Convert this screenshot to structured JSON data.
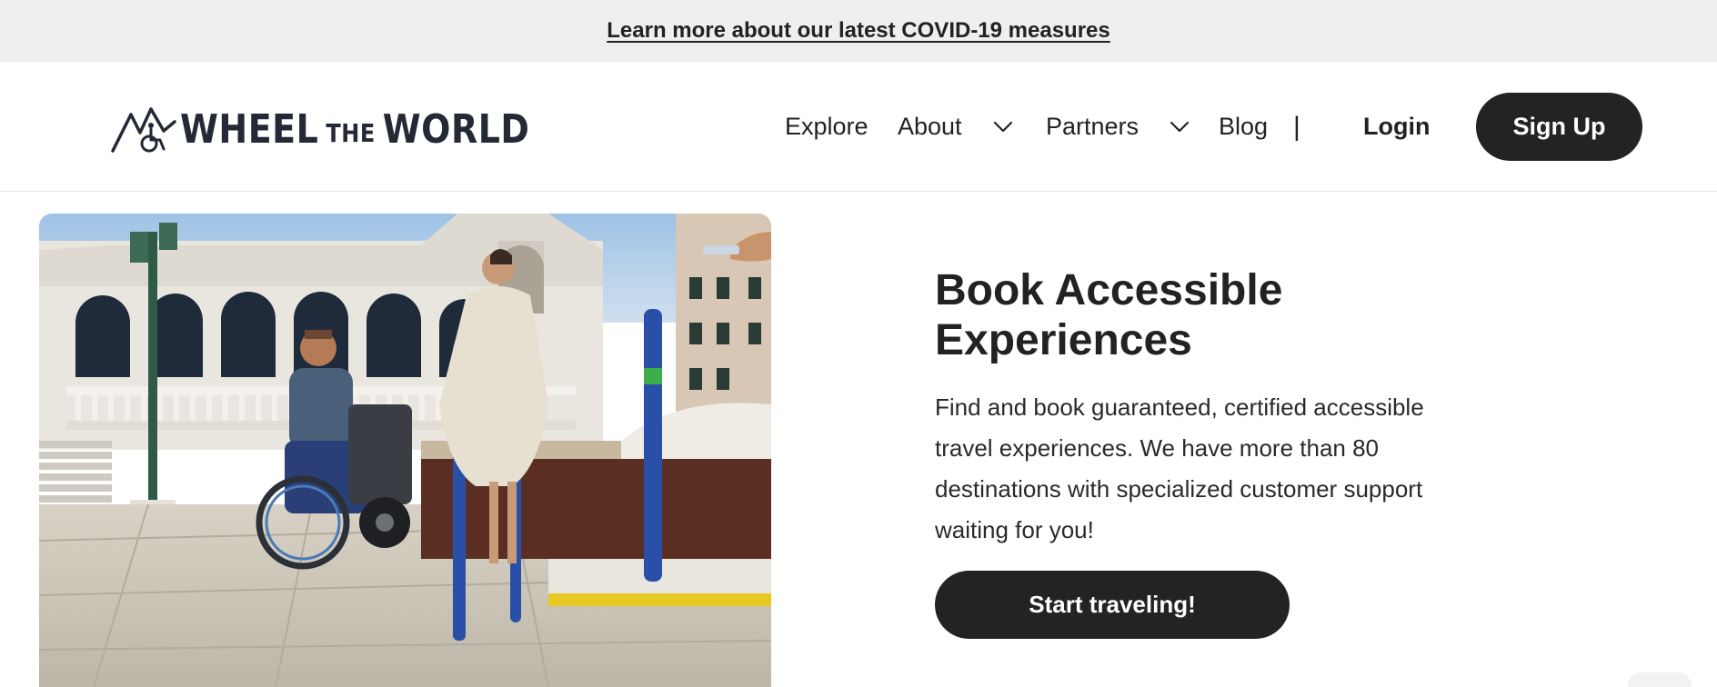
{
  "banner": {
    "link_text": "Learn more about our latest COVID-19 measures"
  },
  "header": {
    "logo": {
      "part1": "WHEEL",
      "part2": "THE",
      "part3": "WORLD"
    },
    "nav": {
      "explore": "Explore",
      "about": "About",
      "partners": "Partners",
      "blog": "Blog",
      "separator": "|",
      "login": "Login",
      "signup": "Sign Up"
    }
  },
  "hero": {
    "title": "Book Accessible Experiences",
    "description": "Find and book guaranteed, certified accessible travel experiences. We have more than 80 destinations with specialized customer support waiting for you!",
    "cta": "Start traveling!"
  },
  "colors": {
    "banner_bg": "#efefef",
    "button_bg": "#232323",
    "logo": "#232a35"
  },
  "icons": [
    "mountain-wheelchair-logo",
    "chevron-down-icon"
  ]
}
